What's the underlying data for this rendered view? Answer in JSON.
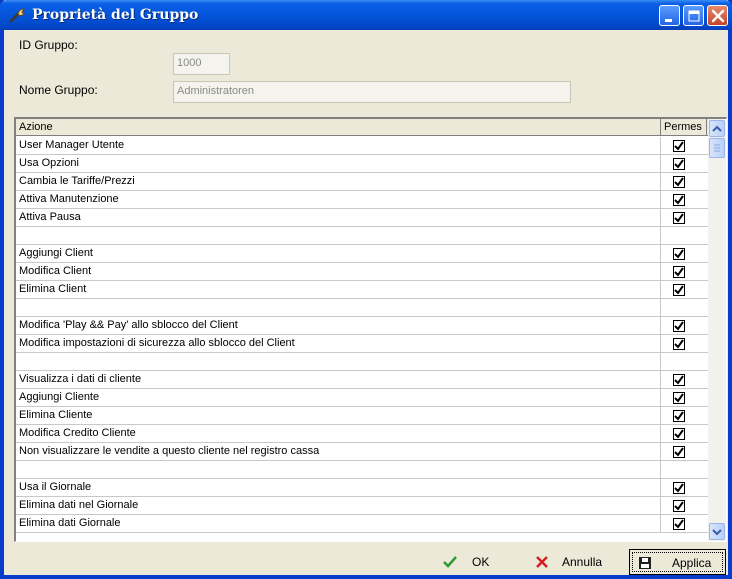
{
  "window": {
    "title": "Proprietà del Gruppo"
  },
  "form": {
    "group_id_label": "ID Gruppo:",
    "group_id_value": "1000",
    "group_name_label": "Nome Gruppo:",
    "group_name_value": "Administratoren"
  },
  "table": {
    "columns": [
      "Azione",
      "Permes"
    ],
    "rows": [
      {
        "action": "User Manager Utente",
        "checked": true
      },
      {
        "action": "Usa Opzioni",
        "checked": true
      },
      {
        "action": "Cambia le Tariffe/Prezzi",
        "checked": true
      },
      {
        "action": "Attiva Manutenzione",
        "checked": true
      },
      {
        "action": "Attiva Pausa",
        "checked": true
      },
      {
        "action": "",
        "checked": null
      },
      {
        "action": "Aggiungi Client",
        "checked": true
      },
      {
        "action": "Modifica Client",
        "checked": true
      },
      {
        "action": "Elimina Client",
        "checked": true
      },
      {
        "action": "",
        "checked": null
      },
      {
        "action": "Modifica 'Play && Pay' allo sblocco del Client",
        "checked": true
      },
      {
        "action": "Modifica impostazioni di sicurezza allo sblocco del Client",
        "checked": true
      },
      {
        "action": "",
        "checked": null
      },
      {
        "action": "Visualizza i dati di cliente",
        "checked": true
      },
      {
        "action": "Aggiungi Cliente",
        "checked": true
      },
      {
        "action": "Elimina Cliente",
        "checked": true
      },
      {
        "action": "Modifica Credito Cliente",
        "checked": true
      },
      {
        "action": "Non visualizzare le vendite a questo cliente nel registro cassa",
        "checked": true
      },
      {
        "action": "",
        "checked": null
      },
      {
        "action": "Usa il Giornale",
        "checked": true
      },
      {
        "action": "Elimina dati nel Giornale",
        "checked": true
      },
      {
        "action": "Elimina dati Giornale",
        "checked": true
      }
    ]
  },
  "buttons": {
    "ok_label": "OK",
    "cancel_label": "Annulla",
    "apply_label": "Applica"
  },
  "colors": {
    "titlebar": "#0455DA",
    "window_bg": "#ECE9D8",
    "ok_icon": "#2E9A2E",
    "cancel_icon": "#D42020"
  },
  "icons": {
    "app": "wrench-icon",
    "minimize": "minimize-icon",
    "maximize": "maximize-icon",
    "close": "close-icon",
    "ok": "checkmark-icon",
    "cancel": "cross-icon",
    "apply": "floppy-disk-icon",
    "check": "checkbox-checked-icon"
  }
}
